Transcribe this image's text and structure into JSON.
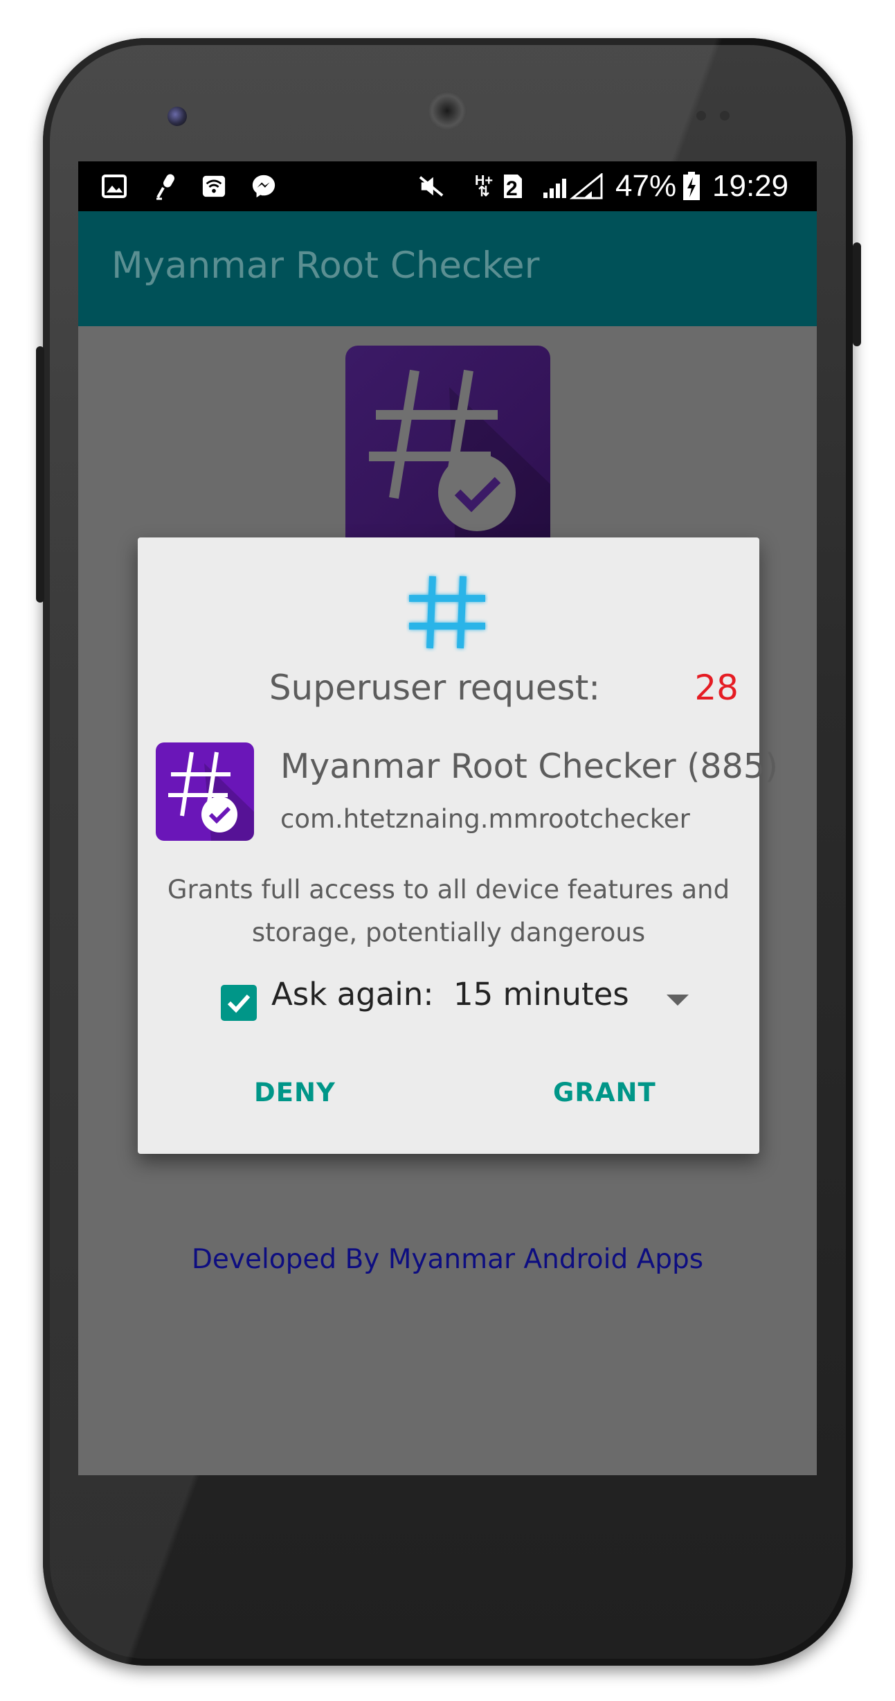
{
  "status_bar": {
    "battery": "47%",
    "time": "19:29",
    "network": "H+",
    "sim": "2",
    "icons": [
      "gallery-icon",
      "microphone-icon",
      "wifi-calling-icon",
      "messenger-icon",
      "mute-icon",
      "signal-icon",
      "battery-charging-icon"
    ]
  },
  "app_bar": {
    "title": "Myanmar Root Checker"
  },
  "dialog": {
    "title": "Superuser request:",
    "countdown": "28",
    "app_name": "Myanmar Root Checker (885)",
    "package": "com.htetznaing.mmrootchecker",
    "warning": "Grants full access to all device features and storage, potentially dangerous",
    "ask_again_label": "Ask again:",
    "ask_again_checked": true,
    "ask_again_value": "15 minutes",
    "deny_label": "DENY",
    "grant_label": "GRANT"
  },
  "footer": {
    "text": "Developed By Myanmar Android Apps"
  },
  "colors": {
    "app_bar": "#005158",
    "accent": "#009688",
    "countdown": "#e51c23",
    "footer_text": "#0d0d80",
    "app_icon": "#6a16b8"
  }
}
